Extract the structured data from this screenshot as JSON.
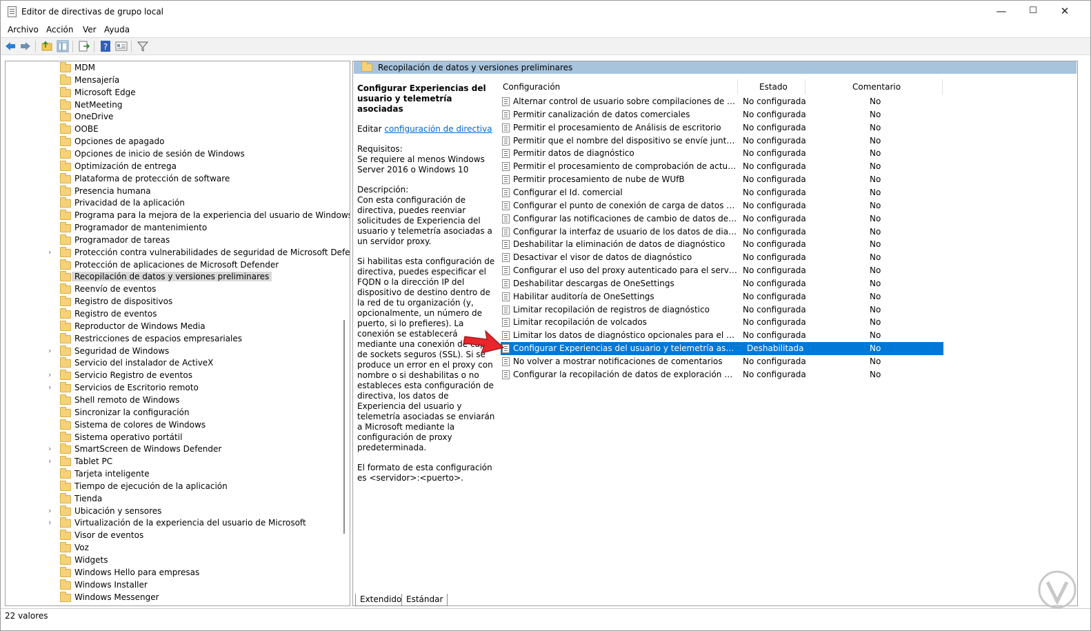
{
  "window": {
    "title": "Editor de directivas de grupo local",
    "minimize": "—",
    "maximize": "☐",
    "close": "✕"
  },
  "menu": [
    "Archivo",
    "Acción",
    "Ver",
    "Ayuda"
  ],
  "toolbar": {
    "icons": [
      "back-arrow-icon",
      "forward-arrow-icon",
      "up-folder-icon",
      "show-hide-tree-icon",
      "export-list-icon",
      "help-icon",
      "properties-icon",
      "filter-icon"
    ]
  },
  "tree": {
    "items": [
      {
        "label": "MDM",
        "expandable": false
      },
      {
        "label": "Mensajería",
        "expandable": false
      },
      {
        "label": "Microsoft Edge",
        "expandable": false
      },
      {
        "label": "NetMeeting",
        "expandable": false
      },
      {
        "label": "OneDrive",
        "expandable": false
      },
      {
        "label": "OOBE",
        "expandable": false
      },
      {
        "label": "Opciones de apagado",
        "expandable": false
      },
      {
        "label": "Opciones de inicio de sesión de Windows",
        "expandable": false
      },
      {
        "label": "Optimización de entrega",
        "expandable": false
      },
      {
        "label": "Plataforma de protección de software",
        "expandable": false
      },
      {
        "label": "Presencia humana",
        "expandable": false
      },
      {
        "label": "Privacidad de la aplicación",
        "expandable": false
      },
      {
        "label": "Programa para la mejora de la experiencia del usuario de Windows",
        "expandable": false
      },
      {
        "label": "Programador de mantenimiento",
        "expandable": false
      },
      {
        "label": "Programador de tareas",
        "expandable": false
      },
      {
        "label": "Protección contra vulnerabilidades de seguridad de Microsoft Defender",
        "expandable": true
      },
      {
        "label": "Protección de aplicaciones de Microsoft Defender",
        "expandable": false
      },
      {
        "label": "Recopilación de datos y versiones preliminares",
        "expandable": false,
        "selected": true
      },
      {
        "label": "Reenvío de eventos",
        "expandable": false
      },
      {
        "label": "Registro de dispositivos",
        "expandable": false
      },
      {
        "label": "Registro de eventos",
        "expandable": false
      },
      {
        "label": "Reproductor de Windows Media",
        "expandable": false
      },
      {
        "label": "Restricciones de espacios empresariales",
        "expandable": false
      },
      {
        "label": "Seguridad de Windows",
        "expandable": true
      },
      {
        "label": "Servicio del instalador de ActiveX",
        "expandable": false
      },
      {
        "label": "Servicio Registro de eventos",
        "expandable": true
      },
      {
        "label": "Servicios de Escritorio remoto",
        "expandable": true
      },
      {
        "label": "Shell remoto de Windows",
        "expandable": false
      },
      {
        "label": "Sincronizar la configuración",
        "expandable": false
      },
      {
        "label": "Sistema de colores de Windows",
        "expandable": false
      },
      {
        "label": "Sistema operativo portátil",
        "expandable": false
      },
      {
        "label": "SmartScreen de Windows Defender",
        "expandable": true
      },
      {
        "label": "Tablet PC",
        "expandable": true
      },
      {
        "label": "Tarjeta inteligente",
        "expandable": false
      },
      {
        "label": "Tiempo de ejecución de la aplicación",
        "expandable": false
      },
      {
        "label": "Tienda",
        "expandable": false
      },
      {
        "label": "Ubicación y sensores",
        "expandable": true
      },
      {
        "label": "Virtualización de la experiencia del usuario de Microsoft",
        "expandable": true
      },
      {
        "label": "Visor de eventos",
        "expandable": false
      },
      {
        "label": "Voz",
        "expandable": false
      },
      {
        "label": "Widgets",
        "expandable": false
      },
      {
        "label": "Windows Hello para empresas",
        "expandable": false
      },
      {
        "label": "Windows Installer",
        "expandable": false
      },
      {
        "label": "Windows Messenger",
        "expandable": false
      }
    ]
  },
  "right": {
    "header": "Recopilación de datos y versiones preliminares",
    "description": {
      "title": "Configurar Experiencias del usuario y telemetría asociadas",
      "edit_prefix": "Editar",
      "edit_link": "configuración de directiva",
      "requirements_label": "Requisitos:",
      "requirements_text": "Se requiere al menos Windows Server 2016 o Windows 10",
      "description_label": "Descripción:",
      "paragraph1": "Con esta configuración de directiva, puedes reenviar solicitudes de Experiencia del usuario y telemetría asociadas a un servidor proxy.",
      "paragraph2": "Si habilitas esta configuración de directiva, puedes especificar el FQDN o la dirección IP del dispositivo de destino dentro de la red de tu organización (y, opcionalmente, un número de puerto, si lo prefieres). La conexión se establecerá mediante una conexión de capa de sockets seguros (SSL). Si se produce un error en el proxy con nombre o si deshabilitas o no estableces esta configuración de directiva, los datos de Experiencia del usuario y telemetría asociadas se enviarán a Microsoft mediante la configuración de proxy predeterminada.",
      "paragraph3": "El formato de esta configuración es <servidor>:<puerto>."
    },
    "columns": {
      "config": "Configuración",
      "state": "Estado",
      "comment": "Comentario"
    },
    "policies": [
      {
        "name": "Alternar control de usuario sobre compilaciones de Insider",
        "state": "No configurada",
        "comment": "No"
      },
      {
        "name": "Permitir canalización de datos comerciales",
        "state": "No configurada",
        "comment": "No"
      },
      {
        "name": "Permitir el procesamiento de Análisis de escritorio",
        "state": "No configurada",
        "comment": "No"
      },
      {
        "name": "Permitir que el nombre del dispositivo se envíe junto a los d...",
        "state": "No configurada",
        "comment": "No"
      },
      {
        "name": "Permitir datos de diagnóstico",
        "state": "No configurada",
        "comment": "No"
      },
      {
        "name": "Permitir el procesamiento de comprobación de actualizacio...",
        "state": "No configurada",
        "comment": "No"
      },
      {
        "name": "Permitir procesamiento de nube de WUfB",
        "state": "No configurada",
        "comment": "No"
      },
      {
        "name": "Configurar el Id. comercial",
        "state": "No configurada",
        "comment": "No"
      },
      {
        "name": "Configurar el punto de conexión de carga de datos de diagn...",
        "state": "No configurada",
        "comment": "No"
      },
      {
        "name": "Configurar las notificaciones de cambio de datos de diagnó...",
        "state": "No configurada",
        "comment": "No"
      },
      {
        "name": "Configurar la interfaz de usuario de los datos de diagnóstico",
        "state": "No configurada",
        "comment": "No"
      },
      {
        "name": "Deshabilitar la eliminación de datos de diagnóstico",
        "state": "No configurada",
        "comment": "No"
      },
      {
        "name": "Desactivar el visor de datos de diagnóstico",
        "state": "No configurada",
        "comment": "No"
      },
      {
        "name": "Configurar el uso del proxy autenticado para el servicio de E...",
        "state": "No configurada",
        "comment": "No"
      },
      {
        "name": "Deshabilitar descargas de OneSettings",
        "state": "No configurada",
        "comment": "No"
      },
      {
        "name": "Habilitar auditoría de OneSettings",
        "state": "No configurada",
        "comment": "No"
      },
      {
        "name": "Limitar recopilación de registros de diagnóstico",
        "state": "No configurada",
        "comment": "No"
      },
      {
        "name": "Limitar recopilación de volcados",
        "state": "No configurada",
        "comment": "No"
      },
      {
        "name": "Limitar los datos de diagnóstico opcionales para el análisis d...",
        "state": "No configurada",
        "comment": "No"
      },
      {
        "name": "Configurar Experiencias del usuario y telemetría asociadas",
        "state": "Deshabilitada",
        "comment": "No",
        "selected": true
      },
      {
        "name": "No volver a mostrar notificaciones de comentarios",
        "state": "No configurada",
        "comment": "No"
      },
      {
        "name": "Configurar la recopilación de datos de exploración para Aná...",
        "state": "No configurada",
        "comment": "No"
      }
    ],
    "tabs": [
      "Extendido",
      "Estándar"
    ]
  },
  "status": {
    "text": "22 valores"
  },
  "colors": {
    "selection": "#0078d7",
    "header_bar": "#a8c4dd",
    "link": "#0066cc",
    "arrow": "#e8262b"
  }
}
